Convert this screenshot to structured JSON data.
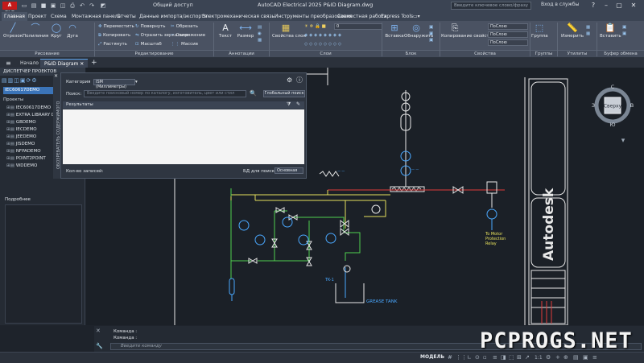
{
  "titlebar": {
    "app_badge": "A ELE",
    "share": "Общий доступ",
    "title": "AutoCAD Electrical 2025   P&ID Diagram.dwg",
    "search_placeholder": "Введите ключевое слово/фразу",
    "login": "Вход в службы"
  },
  "menu": {
    "tabs": [
      "Главная",
      "Проект",
      "Схема",
      "Монтажная панель",
      "Отчеты",
      "Данные импорта/экспорта",
      "Электромеханическая связь",
      "Инструменты преобразования",
      "Совместная работа",
      "Express Tools"
    ]
  },
  "ribbon": {
    "draw": {
      "line": "Отрезок",
      "polyline": "Полилиния",
      "circle": "Круг",
      "arc": "Дуга"
    },
    "modify": {
      "move": "Переместить",
      "rotate": "Повернуть",
      "trim": "Обрезать",
      "copy": "Копировать",
      "mirror": "Отразить зеркально",
      "fillet": "Сопряжение",
      "stretch": "Растянуть",
      "scale": "Масштаб",
      "array": "Массив"
    },
    "annotation": {
      "text": "Текст",
      "dimension": "Размер"
    },
    "properties_btn": "Свойства слоя",
    "block": {
      "insert": "Вставка",
      "detect": "Обнаружить"
    },
    "copy_props": "Копирование свойств",
    "group": "Группа",
    "measure": "Измерить",
    "paste": "Вставить",
    "layer_value": "0",
    "prop_combo_1": "ПоСлою",
    "prop_combo_2": "ПоСлою",
    "prop_combo_3": "ПоСлою",
    "groups": [
      "Рисование",
      "Редактирование",
      "Аннотации",
      "Слои",
      "Блок",
      "Свойства",
      "Группы",
      "Утилиты",
      "Буфер обмена"
    ]
  },
  "doctabs": {
    "home": "Начало",
    "drawing": "P&ID Diagram"
  },
  "project_manager": {
    "header": "ДИСПЕТЧЕР ПРОЕКТОВ",
    "selected_project": "IEC60617DEMO",
    "projects_label": "Проекты",
    "projects": [
      "IEC60617DEMO",
      "EXTRA LIBRARY D",
      "GBDEMO",
      "IECDEMO",
      "JEEDEMO",
      "JISDEMO",
      "NFPADEMO",
      "POINT2POINT",
      "WDDEMO"
    ],
    "details": "Подробнее"
  },
  "content_strip": "ОБОЗРЕВАТЕЛЬ СОДЕРЖИМОГО",
  "dialog": {
    "category_label": "Категория",
    "category_value": "ISM (Миллиметры)",
    "search_label": "Поиск:",
    "search_placeholder": "Введите поисковый номер по каталогу, изготовитель, цвет или стил",
    "global_search": "Глобальный поиск",
    "results_label": "Результаты",
    "record_count_label": "Кол-во записей:",
    "db_label": "БД для поиска",
    "db_value": "Основная"
  },
  "drawing": {
    "label_to_motor": "To Motor",
    "label_protection": "Protection",
    "label_relay": "Relay",
    "tank_label": "GREASE TANK",
    "tk_label": "TK-1",
    "title_block_text": "Autodesk",
    "layer_colors": {
      "yellow": "#e6e05c",
      "green": "#4fd14f",
      "red": "#e23b3b",
      "white": "#e8e8e8",
      "cyan": "#4aa8ff"
    }
  },
  "viewcube": {
    "north": "С",
    "south": "Ю",
    "west": "З",
    "east": "В",
    "face": "Сверху"
  },
  "command": {
    "line1": "Команда :",
    "line2": "Команда :",
    "placeholder": "Введите команду"
  },
  "status": {
    "model": "МОДЕЛЬ",
    "scale": "1:1"
  },
  "watermark": "PCPROGS.NET"
}
